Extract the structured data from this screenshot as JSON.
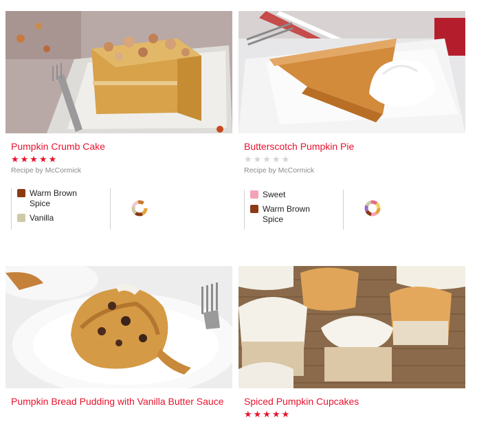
{
  "cards": [
    {
      "title": "Pumpkin Crumb Cake",
      "stars": "★★★★★",
      "byline": "Recipe by McCormick",
      "flavors": [
        {
          "label": "Warm Brown Spice",
          "color": "#8b3a16"
        },
        {
          "label": "Vanilla",
          "color": "#cfc9a8"
        }
      ]
    },
    {
      "title": "Butterscotch Pumpkin Pie",
      "stars": "★★★★★",
      "byline": "Recipe by McCormick",
      "flavors": [
        {
          "label": "Sweet",
          "color": "#f4a3b5"
        },
        {
          "label": "Warm Brown Spice",
          "color": "#8b3a16"
        }
      ]
    },
    {
      "title": "Pumpkin Bread Pudding with Vanilla Butter Sauce"
    },
    {
      "title": "Spiced Pumpkin Cupcakes",
      "stars": "★★★★★"
    }
  ],
  "colors": {
    "accent": "#e8122d",
    "star_empty": "#d4d4d4"
  }
}
